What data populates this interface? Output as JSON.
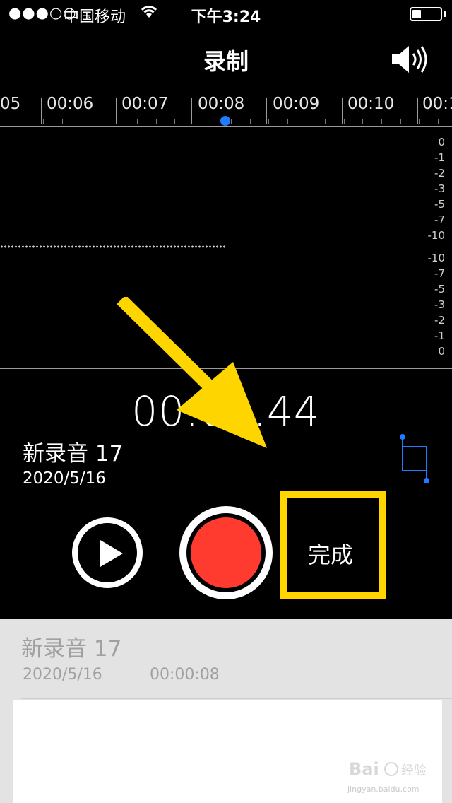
{
  "status_bar": {
    "signal": "●●●○○",
    "carrier": "中国移动",
    "wifi_icon": "wifi-icon",
    "time": "下午3:24",
    "battery_icon": "battery-icon"
  },
  "header": {
    "title": "录制",
    "speaker_icon": "speaker-icon"
  },
  "timeline": {
    "ticks": [
      "05",
      "00:06",
      "00:07",
      "00:08",
      "00:09",
      "00:10",
      "00:1"
    ]
  },
  "db_scale": {
    "top": [
      "0",
      "-1",
      "-2",
      "-3",
      "-5",
      "-7",
      "-10"
    ],
    "bottom": [
      "-10",
      "-7",
      "-5",
      "-3",
      "-2",
      "-1",
      "0"
    ]
  },
  "timer": "00:08.44",
  "recording": {
    "name": "新录音 17",
    "date": "2020/5/16"
  },
  "controls": {
    "done_label": "完成"
  },
  "list": {
    "name": "新录音 17",
    "date": "2020/5/16",
    "duration": "00:00:08"
  },
  "watermark": {
    "text": "jingyan.baidu.com"
  },
  "colors": {
    "accent": "#1f7bff",
    "record": "#ff3b30",
    "highlight": "#ffd500"
  }
}
